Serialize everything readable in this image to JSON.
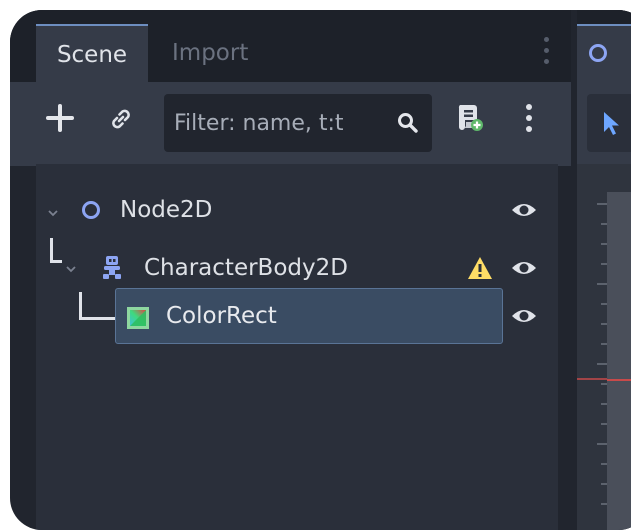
{
  "dock": {
    "tabs": [
      {
        "label": "Scene",
        "active": true
      },
      {
        "label": "Import",
        "active": false
      }
    ]
  },
  "toolbar": {
    "add_icon": "plus-icon",
    "link_icon": "link-icon",
    "filter": {
      "placeholder": "Filter: name, t:t",
      "value": ""
    },
    "search_icon": "search-icon",
    "script_icon": "attach-script-icon",
    "menu_icon": "kebab-menu-icon"
  },
  "tree": {
    "nodes": [
      {
        "label": "Node2D",
        "icon": "node2d-icon",
        "expanded": true,
        "visible": true,
        "warning": false
      },
      {
        "label": "CharacterBody2D",
        "icon": "characterbody2d-icon",
        "expanded": true,
        "visible": true,
        "warning": true
      },
      {
        "label": "ColorRect",
        "icon": "colorrect-icon",
        "selected": true,
        "visible": true,
        "warning": false
      }
    ]
  },
  "colors": {
    "accent": "#6d8ec0",
    "selection": "#3a4c63",
    "warning": "#ffdd66",
    "node2d": "#8da5f3",
    "characterbody": "#8da5f3"
  }
}
